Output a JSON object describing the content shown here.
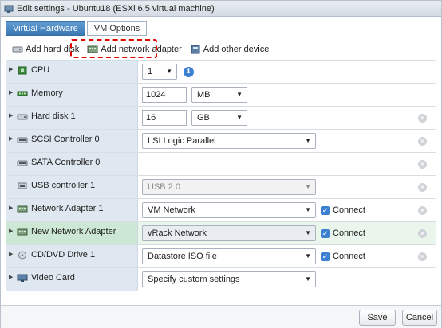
{
  "window": {
    "title": "Edit settings - Ubuntu18 (ESXi 6.5 virtual machine)"
  },
  "tabs": [
    {
      "label": "Virtual Hardware",
      "active": true
    },
    {
      "label": "VM Options",
      "active": false
    }
  ],
  "toolbar": {
    "add_hard_disk": "Add hard disk",
    "add_network_adapter": "Add network adapter",
    "add_other_device": "Add other device"
  },
  "rows": {
    "cpu": {
      "label": "CPU",
      "value": "1"
    },
    "memory": {
      "label": "Memory",
      "value": "1024",
      "unit": "MB"
    },
    "hard_disk": {
      "label": "Hard disk 1",
      "value": "16",
      "unit": "GB"
    },
    "scsi": {
      "label": "SCSI Controller 0",
      "value": "LSI Logic Parallel"
    },
    "sata": {
      "label": "SATA Controller 0"
    },
    "usb": {
      "label": "USB controller 1",
      "value": "USB 2.0"
    },
    "net1": {
      "label": "Network Adapter 1",
      "value": "VM Network",
      "connect": "Connect"
    },
    "newnet": {
      "label": "New Network Adapter",
      "value": "vRack Network",
      "connect": "Connect"
    },
    "cddvd": {
      "label": "CD/DVD Drive 1",
      "value": "Datastore ISO file",
      "connect": "Connect"
    },
    "video": {
      "label": "Video Card",
      "value": "Specify custom settings"
    }
  },
  "footer": {
    "save": "Save",
    "cancel": "Cancel"
  },
  "colors": {
    "accent": "#3d7fd0",
    "highlight_box": "#e00000",
    "selected_row": "#cce7d3"
  }
}
